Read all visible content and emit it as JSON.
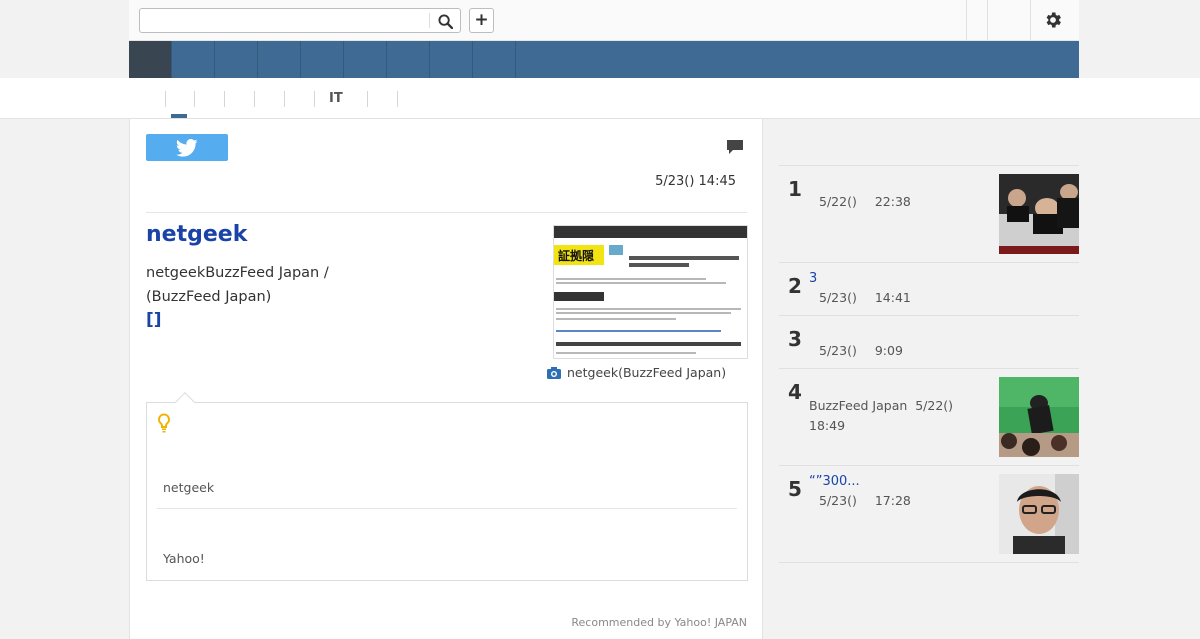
{
  "header": {
    "search_placeholder": "",
    "search_icon": "search-icon",
    "add_label": "+",
    "settings_icon": "gear-icon"
  },
  "nav": {
    "items": [
      "",
      "",
      "",
      "",
      "",
      "",
      "",
      "",
      ""
    ],
    "active_index": 0
  },
  "subnav": {
    "items": [
      "",
      "",
      "",
      "",
      "",
      "IT",
      ""
    ],
    "active_index": 0
  },
  "article": {
    "tweet_icon": "twitter-bird-icon",
    "comment_icon": "speech-bubble-icon",
    "timestamp": "5/23() 14:45",
    "source_name": "netgeek",
    "summary": "netgeekBuzzFeed Japan /\n(BuzzFeed Japan)",
    "more_link": "[]",
    "thumbnail_badge": "証拠隠",
    "photo_credit": "netgeek(BuzzFeed Japan)",
    "camera_icon": "camera-icon"
  },
  "tip": {
    "bulb_icon": "lightbulb-icon",
    "text1": "netgeek",
    "text2": "Yahoo!"
  },
  "recommended": "Recommended by Yahoo! JAPAN",
  "ranking": [
    {
      "rank": "1",
      "title": "",
      "source": "",
      "date": "5/22()",
      "time": "22:38",
      "has_thumb": true
    },
    {
      "rank": "2",
      "title": "3",
      "source": "",
      "date": "5/23()",
      "time": "14:41",
      "has_thumb": false
    },
    {
      "rank": "3",
      "title": "",
      "source": "",
      "date": "5/23()",
      "time": "9:09",
      "has_thumb": false
    },
    {
      "rank": "4",
      "title": "",
      "source": "BuzzFeed Japan",
      "date": "5/22()",
      "time": "18:49",
      "has_thumb": true
    },
    {
      "rank": "5",
      "title": "“”300...",
      "source": "",
      "date": "5/23()",
      "time": "17:28",
      "has_thumb": true
    }
  ],
  "colors": {
    "nav_bg": "#3f6a94",
    "nav_active": "#3a4552",
    "link": "#1a43a8",
    "twitter": "#55acee",
    "bulb": "#f0b400",
    "camera": "#2c6fb5"
  }
}
